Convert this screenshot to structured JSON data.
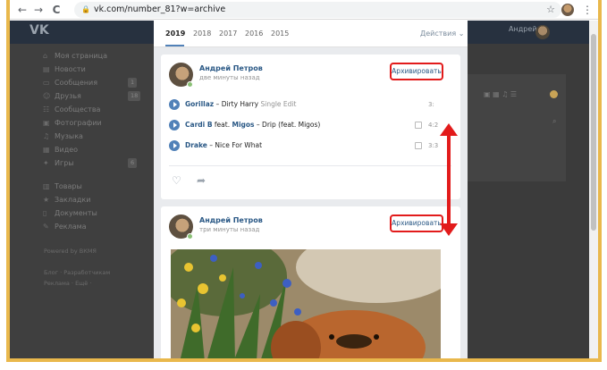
{
  "browser": {
    "url": "vk.com/number_81?w=archive",
    "nav_back": "←",
    "nav_forward": "→",
    "reload": "C",
    "star": "☆",
    "menu": "⋮"
  },
  "vk": {
    "logo": "VK",
    "user": "Андрей",
    "sidebar": [
      {
        "label": "Моя страница",
        "icon": "home-icon"
      },
      {
        "label": "Новости",
        "icon": "news-icon"
      },
      {
        "label": "Сообщения",
        "icon": "messages-icon",
        "count": "1"
      },
      {
        "label": "Друзья",
        "icon": "friends-icon",
        "count": "18"
      },
      {
        "label": "Сообщества",
        "icon": "groups-icon"
      },
      {
        "label": "Фотографии",
        "icon": "photos-icon"
      },
      {
        "label": "Музыка",
        "icon": "music-icon"
      },
      {
        "label": "Видео",
        "icon": "video-icon"
      },
      {
        "label": "Игры",
        "icon": "games-icon",
        "count": "6"
      },
      {
        "label": "Товары",
        "icon": "goods-icon"
      },
      {
        "label": "Закладки",
        "icon": "bookmarks-icon"
      },
      {
        "label": "Документы",
        "icon": "docs-icon"
      },
      {
        "label": "Реклама",
        "icon": "ads-icon"
      }
    ],
    "powered": "Powered by ВКМЯ",
    "footer1": "Блог · Разработчикам",
    "footer2": "Реклама · Ещё ·"
  },
  "archive": {
    "years": [
      "2019",
      "2018",
      "2017",
      "2016",
      "2015"
    ],
    "actions": "Действия ⌄",
    "posts": [
      {
        "author": "Андрей Петров",
        "time": "две минуты назад",
        "archive_label": "Архивировать",
        "tracks": [
          {
            "artist": "Gorillaz",
            "sep": " – ",
            "title": "Dirty Harry",
            "sub": " Single Edit",
            "dur": "3:"
          },
          {
            "artist": "Cardi B",
            "mid": " feat. ",
            "feat": "Migos",
            "sep": " – ",
            "title": "Drip (feat. Migos)",
            "dur": "4:2"
          },
          {
            "artist": "Drake",
            "sep": " – ",
            "title": "Nice For What",
            "dur": "3:3"
          }
        ]
      },
      {
        "author": "Андрей Петров",
        "time": "три минуты назад",
        "archive_label": "Архивировать"
      }
    ]
  },
  "colors": {
    "accent": "#5181b8",
    "highlight": "#e21b1b",
    "frame": "#e9b84c"
  }
}
